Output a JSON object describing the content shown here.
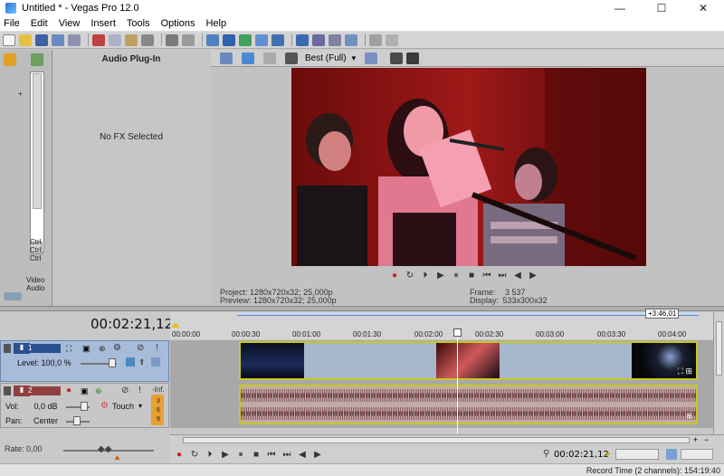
{
  "window": {
    "title": "Untitled * - Vegas Pro 12.0",
    "min_label": "—",
    "max_label": "☐",
    "close_label": "✕"
  },
  "menu": [
    "File",
    "Edit",
    "View",
    "Insert",
    "Tools",
    "Options",
    "Help"
  ],
  "plugin_panel": {
    "title": "Audio Plug-In",
    "empty_text": "No FX Selected"
  },
  "side_list": {
    "items": [
      "Ctrl",
      "Ctrl",
      "Ctrl"
    ],
    "video": "Video",
    "audio": "Audio"
  },
  "preview": {
    "quality": "Best (Full)",
    "project_label": "Project:",
    "project_value": "1280x720x32; 25,000p",
    "preview_label": "Preview:",
    "preview_value": "1280x720x32; 25,000p",
    "frame_label": "Frame:",
    "frame_value": "3 537",
    "display_label": "Display:",
    "display_value": "533x300x32"
  },
  "timeline": {
    "timecode": "00:02:21,12",
    "badge": "+3:46,01",
    "ruler": [
      "00:00:00",
      "00:00:30",
      "00:01:00",
      "00:01:30",
      "00:02:00",
      "00:02:30",
      "00:03:00",
      "00:03:30",
      "00:04:00"
    ],
    "track1": {
      "number": "1",
      "level_label": "Level:",
      "level_value": "100,0 %"
    },
    "track2": {
      "number": "2",
      "vol_label": "Vol:",
      "vol_value": "0,0 dB",
      "pan_label": "Pan:",
      "pan_value": "Center",
      "mode": "Touch",
      "meter_top": "-Inf.",
      "meter_vals": [
        "3",
        "6",
        "9"
      ]
    }
  },
  "bottom": {
    "rate": "Rate: 0,00",
    "timecode": "00:02:21,12",
    "status": "Record Time (2 channels): 154:19:40"
  },
  "colors": {
    "accent": "#5f86c4",
    "clip_border": "#c8c820",
    "record": "#cc2222"
  }
}
